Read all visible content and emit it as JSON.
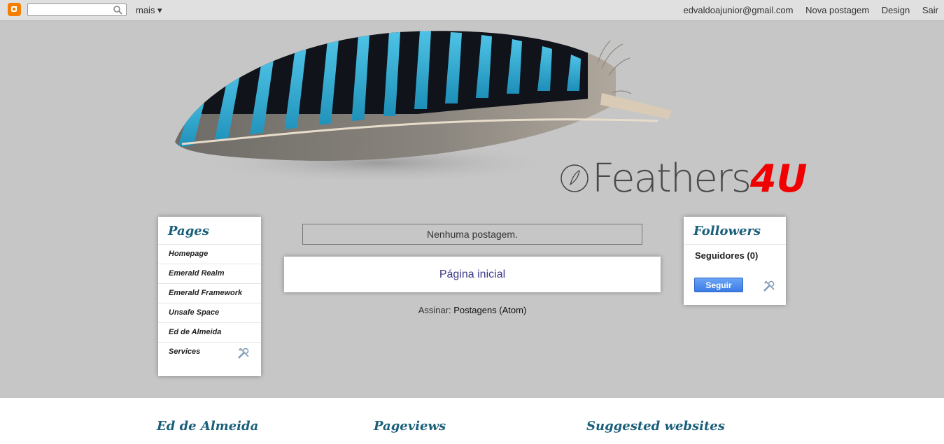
{
  "navbar": {
    "search_value": "",
    "more_label": "mais ▾",
    "email": "edvaldoajunior@gmail.com",
    "new_post": "Nova postagem",
    "design": "Design",
    "logout": "Sair"
  },
  "header": {
    "title_main": "Feathers",
    "title_accent": "4U"
  },
  "pages_widget": {
    "title": "Pages",
    "items": [
      {
        "label": "Homepage"
      },
      {
        "label": "Emerald Realm"
      },
      {
        "label": "Emerald Framework"
      },
      {
        "label": "Unsafe Space"
      },
      {
        "label": "Ed de Almeida"
      },
      {
        "label": "Services"
      }
    ]
  },
  "main": {
    "no_posts": "Nenhuma postagem.",
    "home_link": "Página inicial",
    "subscribe_label": "Assinar: ",
    "subscribe_link": "Postagens (Atom)"
  },
  "followers_widget": {
    "title": "Followers",
    "count_label": "Seguidores (0)",
    "follow_button": "Seguir"
  },
  "footer": {
    "col1_title": "Ed de Almeida",
    "col2_title": "Pageviews",
    "col3_title": "Suggested websites"
  },
  "colors": {
    "background": "#c6c6c6",
    "widget_title": "#1a5f7a",
    "title_accent": "#f00000",
    "follow_button": "#3b7ce6"
  }
}
